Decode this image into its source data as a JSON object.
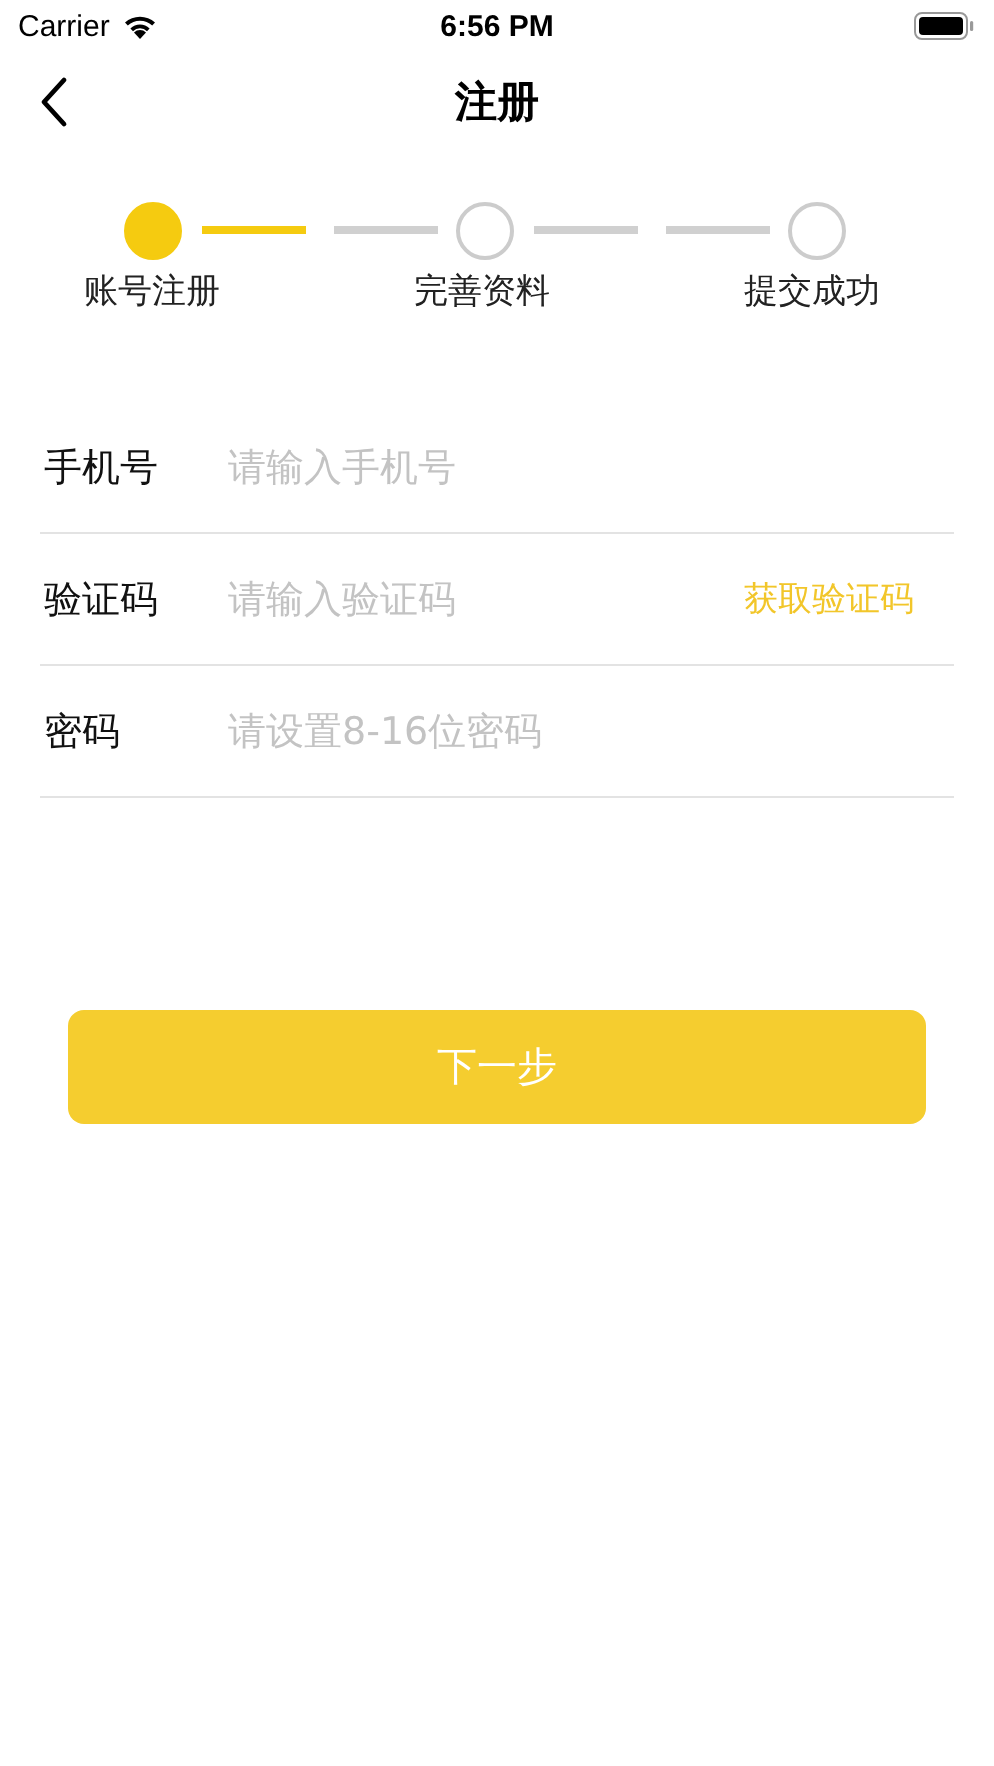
{
  "status_bar": {
    "carrier": "Carrier",
    "time": "6:56 PM"
  },
  "nav": {
    "title": "注册"
  },
  "steps": [
    {
      "label": "账号注册",
      "selected": true
    },
    {
      "label": "完善资料",
      "selected": false
    },
    {
      "label": "提交成功",
      "selected": false
    }
  ],
  "fields": [
    {
      "label": "手机号",
      "placeholder": "请输入手机号"
    },
    {
      "label": "验证码",
      "placeholder": "请输入验证码",
      "action": "获取验证码"
    },
    {
      "label": "密码",
      "placeholder": "请设置8-16位密码"
    }
  ],
  "next_button": "下一步"
}
